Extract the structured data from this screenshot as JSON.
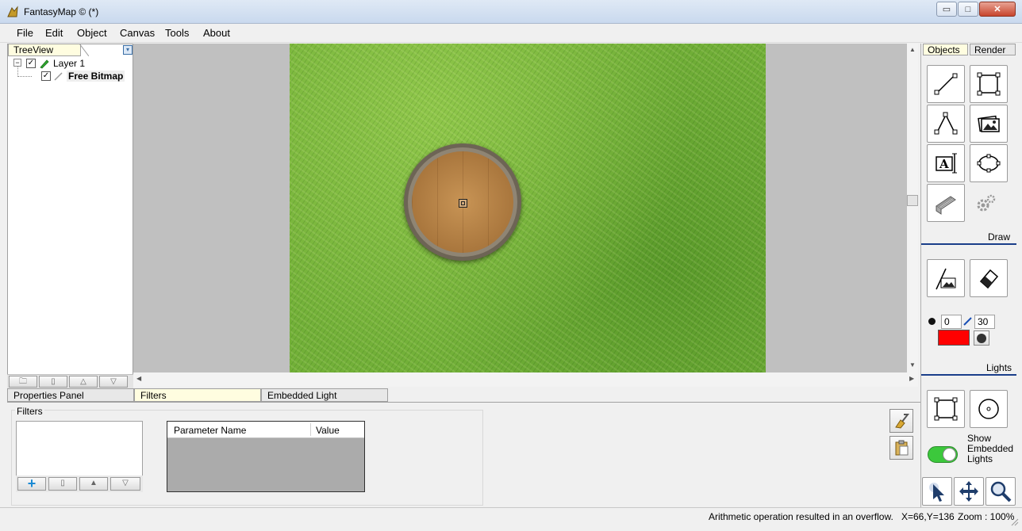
{
  "window": {
    "title": "FantasyMap © (*)",
    "minimize_glyph": "▭",
    "maximize_glyph": "□",
    "close_glyph": "✕"
  },
  "menu": {
    "items": [
      "File",
      "Edit",
      "Object",
      "Canvas",
      "Tools",
      "About"
    ]
  },
  "treeview": {
    "tab_label": "TreeView",
    "layer": {
      "label": "Layer 1",
      "checked": true
    },
    "item": {
      "label": "Free Bitmap",
      "checked": true
    }
  },
  "right_panel": {
    "tabs": [
      "Objects",
      "Render"
    ],
    "draw_label": "Draw",
    "lights_label": "Lights",
    "brush_size": "0",
    "brush_value": "30",
    "brush_color": "#ff0000",
    "embedded_label_line1": "Show",
    "embedded_label_line2": "Embedded",
    "embedded_label_line3": "Lights",
    "toggle_color": "#3cc83c"
  },
  "bottom_tabs": [
    "Properties Panel",
    "Filters",
    "Embedded Light"
  ],
  "filters": {
    "group_title": "Filters",
    "table_headers": [
      "Parameter Name",
      "Value"
    ]
  },
  "status": {
    "message": "Arithmetic operation resulted in an overflow.",
    "coords": "X=66,Y=136",
    "zoom": "Zoom : 100%"
  }
}
